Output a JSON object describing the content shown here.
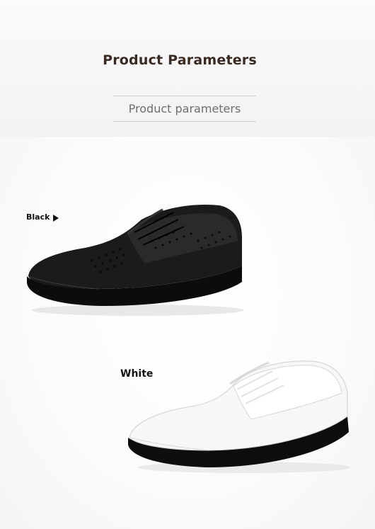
{
  "header": {
    "title": "Product Parameters",
    "subtitle": "Product parameters"
  },
  "variants": [
    {
      "label": "Black",
      "color": "#1a1a1a"
    },
    {
      "label": "White",
      "color": "#f4f4f4"
    }
  ],
  "icons": {
    "black_pointer": "triangle-right-icon"
  }
}
